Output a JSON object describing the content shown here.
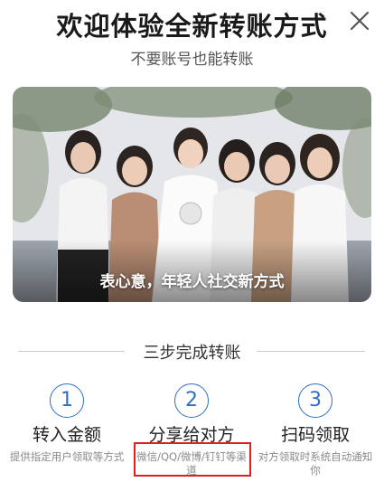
{
  "header": {
    "title": "欢迎体验全新转账方式",
    "subtitle": "不要账号也能转账",
    "close_icon": "close-icon"
  },
  "banner": {
    "caption": "表心意，年轻人社交新方式",
    "image": "group-photo-of-women-making-heart-gestures"
  },
  "steps_section": {
    "title": "三步完成转账",
    "steps": [
      {
        "number": "1",
        "title": "转入金额",
        "desc": "提供指定用户领取等方式"
      },
      {
        "number": "2",
        "title": "分享给对方",
        "desc": "微信/QQ/微博/钉钉等渠道"
      },
      {
        "number": "3",
        "title": "扫码领取",
        "desc": "对方领取时系统自动通知你"
      }
    ]
  },
  "colors": {
    "accent": "#2f6ec8",
    "highlight": "#e02020"
  }
}
